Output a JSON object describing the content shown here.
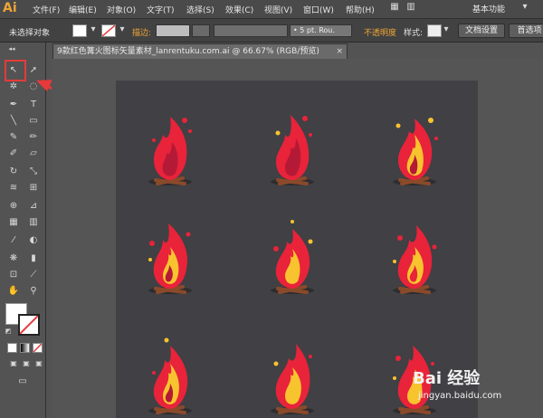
{
  "app": {
    "logo": "Ai"
  },
  "menu": {
    "items": [
      "文件(F)",
      "编辑(E)",
      "对象(O)",
      "文字(T)",
      "选择(S)",
      "效果(C)",
      "视图(V)",
      "窗口(W)",
      "帮助(H)"
    ],
    "workspace": "基本功能"
  },
  "control_bar": {
    "no_selection": "未选择对象",
    "stroke_label": "描边:",
    "stroke_size": "5 pt. Rou.",
    "opacity_label": "不透明度",
    "style_label": "样式:",
    "doc_settings": "文档设置",
    "preferences": "首选项"
  },
  "document": {
    "tab_title": "9款红色篝火图标矢量素材_lanrentuku.com.ai @ 66.67% (RGB/预览)",
    "close": "×"
  },
  "watermark": {
    "text": "Bai 经验",
    "url": "jingyan.baidu.com"
  },
  "colors": {
    "accent": "#f0a534",
    "highlight": "#e63a3a",
    "flame_red": "#e8233a",
    "flame_yellow": "#f7c32e"
  }
}
